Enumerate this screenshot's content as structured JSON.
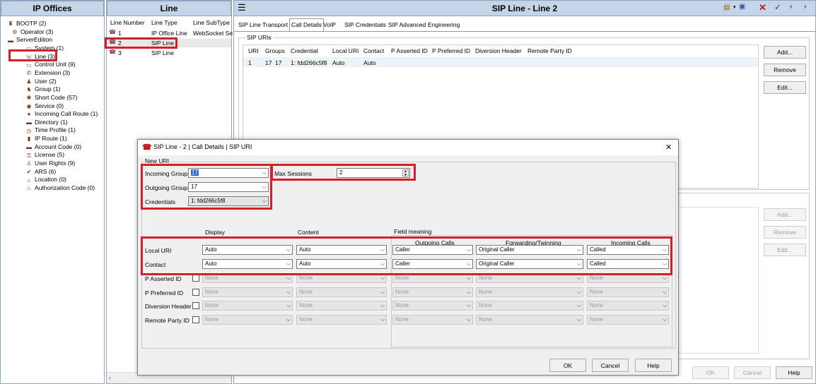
{
  "left_panel": {
    "title": "IP Offices",
    "items": [
      {
        "label": "BOOTP (2)",
        "icon": "bootp-icon"
      },
      {
        "label": "Operator (3)",
        "icon": "operator-icon"
      },
      {
        "label": "ServerEdition",
        "icon": "server-icon"
      },
      {
        "label": "System (1)",
        "icon": "system-icon"
      },
      {
        "label": "Line (3)",
        "icon": "line-icon"
      },
      {
        "label": "Control Unit (9)",
        "icon": "control-unit-icon"
      },
      {
        "label": "Extension (3)",
        "icon": "extension-icon"
      },
      {
        "label": "User (2)",
        "icon": "user-icon"
      },
      {
        "label": "Group (1)",
        "icon": "group-icon"
      },
      {
        "label": "Short Code (57)",
        "icon": "short-code-icon"
      },
      {
        "label": "Service (0)",
        "icon": "service-icon"
      },
      {
        "label": "Incoming Call Route (1)",
        "icon": "incoming-call-route-icon"
      },
      {
        "label": "Directory (1)",
        "icon": "directory-icon"
      },
      {
        "label": "Time Profile (1)",
        "icon": "time-profile-icon"
      },
      {
        "label": "IP Route (1)",
        "icon": "ip-route-icon"
      },
      {
        "label": "Account Code (0)",
        "icon": "account-code-icon"
      },
      {
        "label": "License (5)",
        "icon": "license-icon"
      },
      {
        "label": "User Rights (9)",
        "icon": "user-rights-icon"
      },
      {
        "label": "ARS (6)",
        "icon": "ars-icon"
      },
      {
        "label": "Location (0)",
        "icon": "location-icon"
      },
      {
        "label": "Authorization Code (0)",
        "icon": "authorization-code-icon"
      }
    ]
  },
  "line_panel": {
    "title": "Line",
    "columns": [
      "Line Number",
      "Line Type",
      "Line SubType"
    ],
    "rows": [
      {
        "number": "1",
        "type": "IP Office Line",
        "subtype": "WebSocket Se"
      },
      {
        "number": "2",
        "type": "SIP Line",
        "subtype": ""
      },
      {
        "number": "3",
        "type": "SIP Line",
        "subtype": ""
      }
    ]
  },
  "main": {
    "title": "SIP Line - Line 2",
    "tabs": [
      "SIP Line",
      "Transport",
      "Call Details",
      "VoIP",
      "SIP Credentials",
      "SIP Advanced",
      "Engineering"
    ],
    "active_tab": "Call Details",
    "section_label": "SIP URIs",
    "columns": [
      "URI",
      "Groups",
      "Credential",
      "Local URI",
      "Contact",
      "P Asserted ID",
      "P Preferred ID",
      "Diversion Header",
      "Remote Party ID"
    ],
    "row": {
      "uri": "1",
      "group_in": "17",
      "group_out": "17",
      "credential": "1: fdd266c5f8",
      "local_uri": "Auto",
      "contact": "Auto"
    },
    "buttons": {
      "add": "Add...",
      "remove": "Remove",
      "edit": "Edit..."
    },
    "buttons2": {
      "add": "Add...",
      "remove": "Remove",
      "edit": "Edit..."
    },
    "footer": {
      "ok": "OK",
      "cancel": "Cancel",
      "help": "Help"
    }
  },
  "dialog": {
    "title": "SIP Line - 2 | Call Details | SIP URI",
    "group_label": "New URI",
    "incoming_group_label": "Incoming Group",
    "incoming_group_value": "17",
    "outgoing_group_label": "Outgoing Group",
    "outgoing_group_value": "17",
    "credentials_label": "Credentials",
    "credentials_value": "1: fdd266c5f8",
    "max_sessions_label": "Max Sessions",
    "max_sessions_value": "2",
    "headers": {
      "display": "Display",
      "content": "Content",
      "field_meaning": "Field meaning",
      "outgoing_calls": "Outgoing Calls",
      "forwarding": "Forwarding/Twinning",
      "incoming_calls": "Incoming Calls"
    },
    "rows": [
      {
        "label": "Local URI",
        "display": "Auto",
        "content": "Auto",
        "outgoing": "Caller",
        "forwarding": "Original Caller",
        "incoming": "Called"
      },
      {
        "label": "Contact",
        "display": "Auto",
        "content": "Auto",
        "outgoing": "Caller",
        "forwarding": "Original Caller",
        "incoming": "Called"
      },
      {
        "label": "P Asserted ID",
        "display": "None",
        "content": "None",
        "outgoing": "None",
        "forwarding": "None",
        "incoming": "None"
      },
      {
        "label": "P Preferred  ID",
        "display": "None",
        "content": "None",
        "outgoing": "None",
        "forwarding": "None",
        "incoming": "None"
      },
      {
        "label": "Diversion Header",
        "display": "None",
        "content": "None",
        "outgoing": "None",
        "forwarding": "None",
        "incoming": "None"
      },
      {
        "label": "Remote Party ID",
        "display": "None",
        "content": "None",
        "outgoing": "None",
        "forwarding": "None",
        "incoming": "None"
      }
    ],
    "ok": "OK",
    "cancel": "Cancel",
    "help": "Help",
    "close": "✕"
  },
  "colors": {
    "highlight": "#d61e2a",
    "header_bg": "#c5d4e7"
  }
}
